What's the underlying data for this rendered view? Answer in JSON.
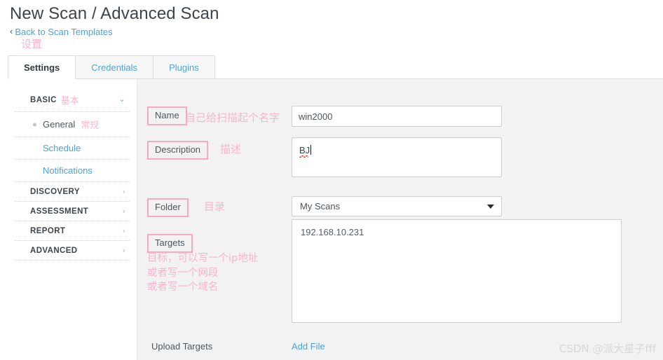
{
  "header": {
    "title": "New Scan / Advanced Scan",
    "back_link": "Back to Scan Templates",
    "back_chevron": "‹",
    "annotation_settings": "设置"
  },
  "tabs": [
    {
      "label": "Settings",
      "active": true
    },
    {
      "label": "Credentials",
      "active": false
    },
    {
      "label": "Plugins",
      "active": false
    }
  ],
  "sidebar": {
    "sections": [
      {
        "label": "BASIC",
        "cn": "基本",
        "caret": "⌄",
        "expanded": true
      },
      {
        "label": "DISCOVERY",
        "cn": "",
        "caret": "›",
        "expanded": false
      },
      {
        "label": "ASSESSMENT",
        "cn": "",
        "caret": "›",
        "expanded": false
      },
      {
        "label": "REPORT",
        "cn": "",
        "caret": "›",
        "expanded": false
      },
      {
        "label": "ADVANCED",
        "cn": "",
        "caret": "›",
        "expanded": false
      }
    ],
    "items": [
      {
        "label": "General",
        "cn": "常规",
        "active": true
      },
      {
        "label": "Schedule",
        "cn": "",
        "active": false
      },
      {
        "label": "Notifications",
        "cn": "",
        "active": false
      }
    ]
  },
  "form": {
    "name": {
      "label": "Name",
      "annotation": "自己给扫描起个名字",
      "value": "win2000"
    },
    "description": {
      "label": "Description",
      "annotation": "描述",
      "value": "BJ"
    },
    "folder": {
      "label": "Folder",
      "annotation": "目录",
      "value": "My Scans"
    },
    "targets": {
      "label": "Targets",
      "annotation": "目标，可以写一个ip地址\n或者写一个网段\n或者写一个域名",
      "value": "192.168.10.231"
    },
    "upload": {
      "label": "Upload Targets",
      "add_file": "Add File"
    }
  },
  "watermark": "CSDN @派大星子fff",
  "colors": {
    "annotation_pink": "#f9b5cd",
    "label_border_pink": "#f7a8c4",
    "link_blue": "#4aa3df",
    "panel_gray": "#f2f2f2",
    "text_dark": "#3c444c"
  }
}
